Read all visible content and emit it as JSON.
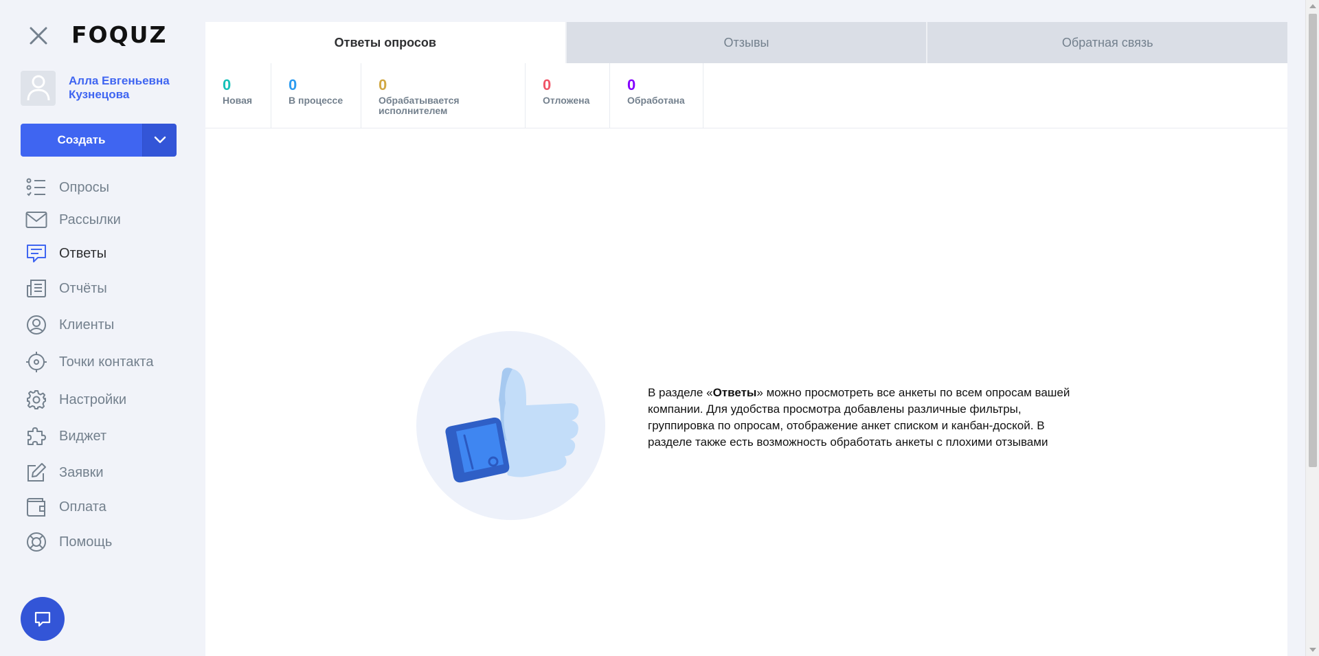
{
  "app": {
    "logo": "FOQUZ"
  },
  "user": {
    "name": "Алла Евгеньевна Кузнецова"
  },
  "create": {
    "label": "Создать"
  },
  "nav": [
    {
      "id": "surveys",
      "label": "Опросы",
      "icon": "list-icon"
    },
    {
      "id": "mailings",
      "label": "Рассылки",
      "icon": "mail-icon"
    },
    {
      "id": "answers",
      "label": "Ответы",
      "icon": "message-icon",
      "active": true
    },
    {
      "id": "reports",
      "label": "Отчёты",
      "icon": "newspaper-icon"
    },
    {
      "id": "clients",
      "label": "Клиенты",
      "icon": "user-circle-icon"
    },
    {
      "id": "contact-points",
      "label": "Точки контакта",
      "icon": "crosshair-icon"
    },
    {
      "id": "settings",
      "label": "Настройки",
      "icon": "gear-icon"
    },
    {
      "id": "widget",
      "label": "Виджет",
      "icon": "puzzle-icon"
    },
    {
      "id": "requests",
      "label": "Заявки",
      "icon": "edit-icon"
    },
    {
      "id": "payment",
      "label": "Оплата",
      "icon": "wallet-icon"
    },
    {
      "id": "help",
      "label": "Помощь",
      "icon": "lifebuoy-icon"
    }
  ],
  "tabs": [
    {
      "label": "Ответы опросов",
      "active": true
    },
    {
      "label": "Отзывы",
      "active": false
    },
    {
      "label": "Обратная связь",
      "active": false
    }
  ],
  "stats": [
    {
      "value": "0",
      "label": "Новая",
      "color": "#16c1b8"
    },
    {
      "value": "0",
      "label": "В процессе",
      "color": "#2d9cf0"
    },
    {
      "value": "0",
      "label": "Обрабатывается исполнителем",
      "color": "#d1a844"
    },
    {
      "value": "0",
      "label": "Отложена",
      "color": "#f05467"
    },
    {
      "value": "0",
      "label": "Обработана",
      "color": "#8400ff"
    }
  ],
  "empty": {
    "text_before": "В разделе «",
    "text_bold": "Ответы",
    "text_after": "» можно просмотреть все анкеты по всем опросам вашей компании. Для удобства просмотра добавлены различные фильтры, группировка по опросам, отображение анкет списком и канбан-доской. В разделе также есть возможность обработать анкеты с плохими отзывами"
  },
  "colors": {
    "accent": "#3f65f1",
    "accent_dark": "#3355d7",
    "sidebar_bg": "#f1f3f9",
    "muted": "#73808d"
  }
}
